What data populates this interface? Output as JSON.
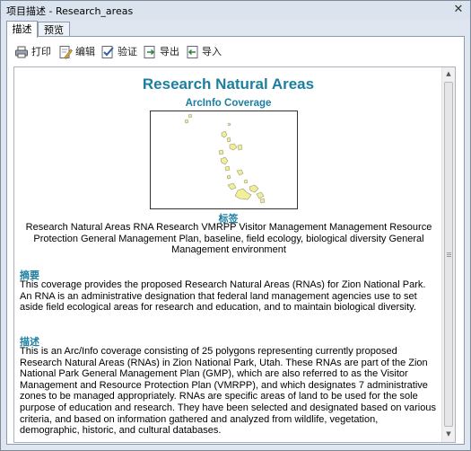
{
  "window": {
    "title": "项目描述 - Research_areas",
    "close_glyph": "✕"
  },
  "tabs": [
    {
      "label": "描述",
      "active": true
    },
    {
      "label": "预览",
      "active": false
    }
  ],
  "toolbar": {
    "print_label": "打印",
    "edit_label": "编辑",
    "validate_label": "验证",
    "export_label": "导出",
    "import_label": "导入"
  },
  "doc": {
    "title": "Research Natural Areas",
    "subtitle": "ArcInfo Coverage",
    "tags_heading": "标签",
    "tags_text": "Research Natural Areas RNA Research VMRPP Visitor Management Management Resource Protection General Management Plan, baseline, field ecology, biological diversity General Management environment",
    "summary_heading": "摘要",
    "summary_text": "This coverage provides the proposed Research Natural Areas (RNAs) for Zion National Park. An RNA is an administrative designation that federal land management agencies use to set aside field ecological areas for research and education, and to maintain biological diversity.",
    "desc_heading": "描述",
    "desc_text": "This is an Arc/Info coverage consisting of 25 polygons representing currently proposed Research Natural Areas (RNAs) in Zion National Park, Utah. These RNAs are part of the Zion National Park General Management Plan (GMP), which are also referred to as the Visitor Management and Resource Protection Plan (VMRPP), and which designates 7 administrative zones to be managed appropriately. RNAs are specific areas of land to be used for the sole purpose of education and research. They have been selected and designated based on various criteria, and based on information gathered and analyzed from wildlife, vegetation, demographic, historic, and cultural databases."
  },
  "scrollbar": {
    "up_glyph": "▲",
    "down_glyph": "▼"
  },
  "colors": {
    "heading": "#1c7fa0",
    "polygon_fill": "#f2ef9a",
    "polygon_edge": "#9a9a70"
  }
}
